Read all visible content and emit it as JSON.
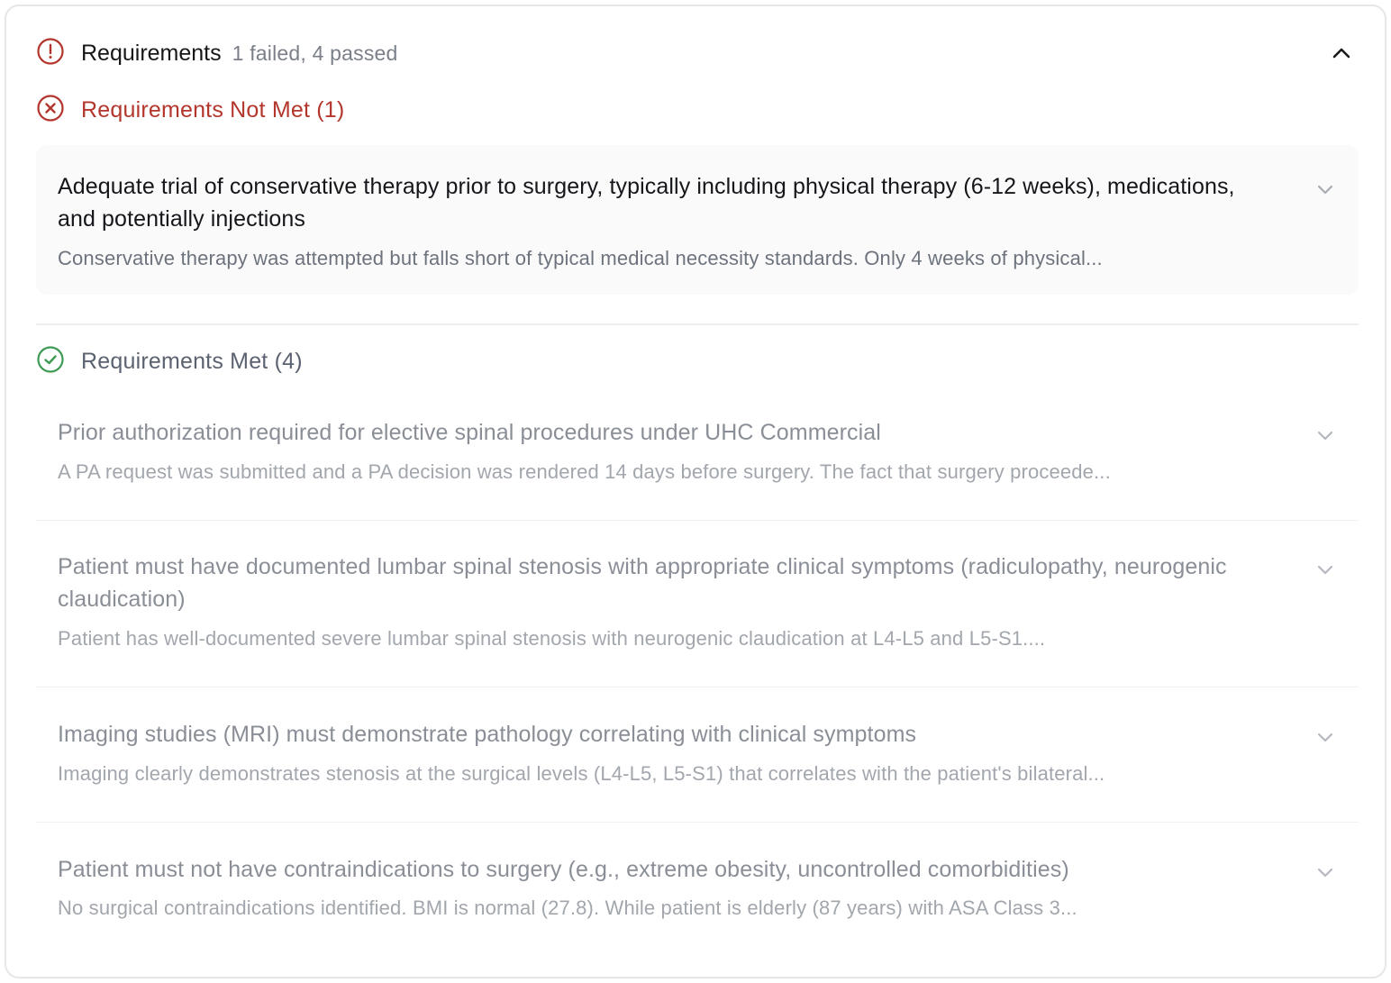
{
  "header": {
    "title": "Requirements",
    "summary": "1 failed, 4 passed"
  },
  "failed_section": {
    "label": "Requirements Not Met (1)",
    "color": "#b3362c",
    "items": [
      {
        "title": "Adequate trial of conservative therapy prior to surgery, typically including physical therapy (6-12 weeks), medications, and potentially injections",
        "description": "Conservative therapy was attempted but falls short of typical medical necessity standards. Only 4 weeks of physical..."
      }
    ]
  },
  "met_section": {
    "label": "Requirements Met (4)",
    "color": "#3f9a55",
    "items": [
      {
        "title": "Prior authorization required for elective spinal procedures under UHC Commercial",
        "description": "A PA request was submitted and a PA decision was rendered 14 days before surgery. The fact that surgery proceede..."
      },
      {
        "title": "Patient must have documented lumbar spinal stenosis with appropriate clinical symptoms (radiculopathy, neurogenic claudication)",
        "description": "Patient has well-documented severe lumbar spinal stenosis with neurogenic claudication at L4-L5 and L5-S1...."
      },
      {
        "title": "Imaging studies (MRI) must demonstrate pathology correlating with clinical symptoms",
        "description": "Imaging clearly demonstrates stenosis at the surgical levels (L4-L5, L5-S1) that correlates with the patient's bilateral..."
      },
      {
        "title": "Patient must not have contraindications to surgery (e.g., extreme obesity, uncontrolled comorbidities)",
        "description": "No surgical contraindications identified. BMI is normal (27.8). While patient is elderly (87 years) with ASA Class 3..."
      }
    ]
  },
  "icons": {
    "header": "alert-circle-icon",
    "failed": "x-circle-icon",
    "met": "check-circle-icon",
    "collapse": "chevron-up-icon",
    "expand": "chevron-down-icon"
  }
}
